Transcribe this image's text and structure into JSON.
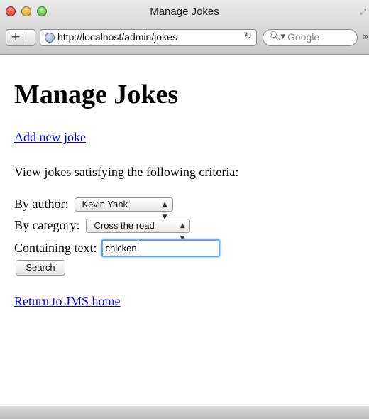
{
  "browser": {
    "window_title": "Manage Jokes",
    "url": "http://localhost/admin/jokes",
    "search_placeholder": "Google",
    "overflow_label": "»"
  },
  "page": {
    "heading": "Manage Jokes",
    "add_link": "Add new joke",
    "intro": "View jokes satisfying the following criteria:",
    "author_label": "By author:",
    "author_selected": "Kevin Yank",
    "category_label": "By category:",
    "category_selected": "Cross the road",
    "text_label": "Containing text:",
    "text_value": "chicken",
    "search_button": "Search",
    "return_link": "Return to JMS home"
  },
  "colors": {
    "link": "#0000ee",
    "focus_ring": "#6fa4e0"
  }
}
